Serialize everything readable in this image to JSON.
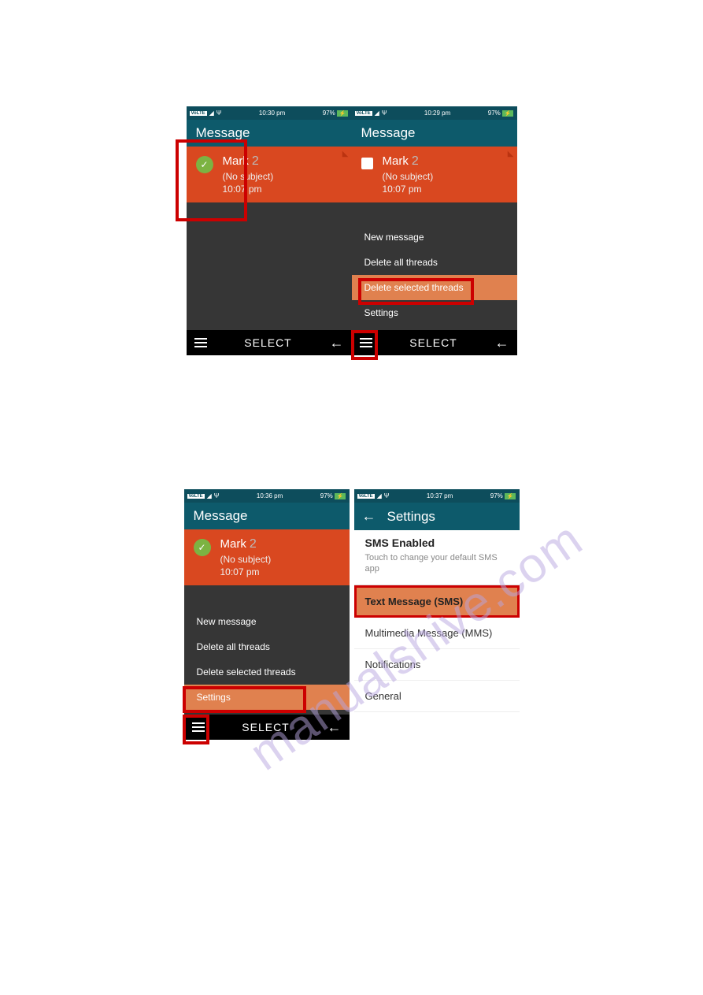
{
  "watermark": "manualshive.com",
  "screens": {
    "a": {
      "status_time": "10:30 pm",
      "battery": "97%",
      "title": "Message",
      "msg_name": "Mark",
      "msg_count": "2",
      "msg_subject": "(No subject)",
      "msg_time": "10:07 pm",
      "select": "SELECT"
    },
    "b": {
      "status_time": "10:29 pm",
      "battery": "97%",
      "title": "Message",
      "msg_name": "Mark",
      "msg_count": "2",
      "msg_subject": "(No subject)",
      "msg_time": "10:07 pm",
      "menu": {
        "new_message": "New message",
        "delete_all": "Delete all threads",
        "delete_selected": "Delete selected threads",
        "settings": "Settings"
      },
      "select": "SELECT"
    },
    "c": {
      "status_time": "10:36 pm",
      "battery": "97%",
      "title": "Message",
      "msg_name": "Mark",
      "msg_count": "2",
      "msg_subject": "(No subject)",
      "msg_time": "10:07 pm",
      "menu": {
        "new_message": "New message",
        "delete_all": "Delete all threads",
        "delete_selected": "Delete selected threads",
        "settings": "Settings"
      },
      "select": "SELECT"
    },
    "d": {
      "status_time": "10:37 pm",
      "battery": "97%",
      "title": "Settings",
      "sms_enabled": "SMS Enabled",
      "sms_desc": "Touch to change your default SMS app",
      "items": {
        "text": "Text Message (SMS)",
        "mms": "Multimedia Message (MMS)",
        "notifications": "Notifications",
        "general": "General"
      }
    }
  }
}
